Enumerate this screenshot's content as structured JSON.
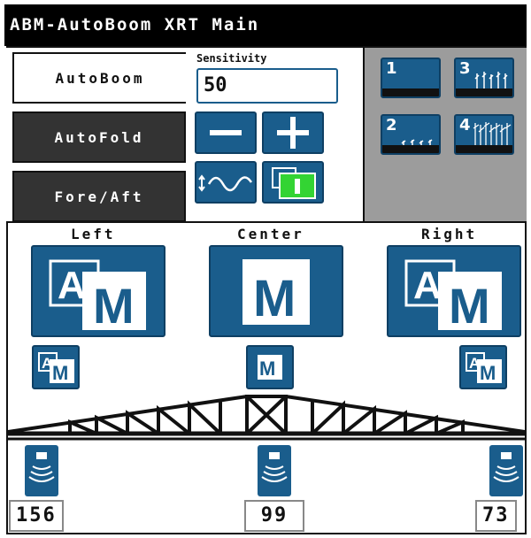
{
  "title": "ABM-AutoBoom XRT Main",
  "tabs": [
    "AutoBoom",
    "AutoFold",
    "Fore/Aft"
  ],
  "active_tab": "AutoBoom",
  "sensitivity": {
    "label": "Sensitivity",
    "value": "50"
  },
  "presets": [
    "1",
    "2",
    "3",
    "4"
  ],
  "sections": {
    "left": {
      "label": "Left",
      "mode": "A/M"
    },
    "center": {
      "label": "Center",
      "mode": "M"
    },
    "right": {
      "label": "Right",
      "mode": "A/M"
    }
  },
  "sensors": {
    "left": "156",
    "center": "99",
    "right": "73"
  },
  "colors": {
    "accent": "#1a5d8c",
    "toggle_on": "#33d433",
    "title_bg": "#000000",
    "panel_gray": "#9c9c9c"
  },
  "icons": {
    "minus": "minus-icon",
    "plus": "plus-icon",
    "wave": "terrain-wave-icon",
    "toggle": "power-toggle-icon",
    "sensor": "ultrasonic-sensor-icon"
  }
}
